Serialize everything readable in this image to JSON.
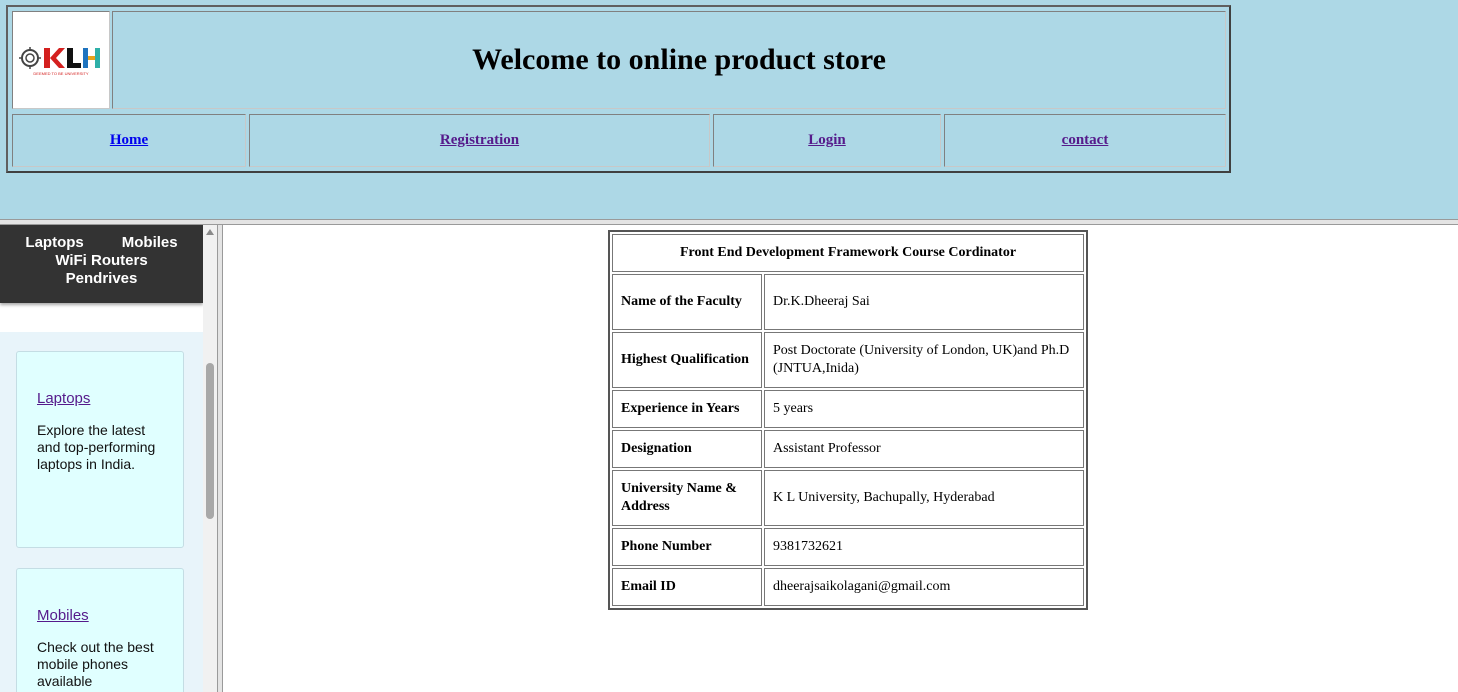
{
  "header": {
    "logo_text": "KLH",
    "logo_subtext": "DEEMED TO BE UNIVERSITY",
    "title": "Welcome to online product store",
    "nav": [
      {
        "label": "Home"
      },
      {
        "label": "Registration"
      },
      {
        "label": "Login"
      },
      {
        "label": "contact"
      }
    ]
  },
  "sidebar": {
    "categories": [
      "Laptops",
      "Mobiles",
      "WiFi Routers",
      "Pendrives"
    ],
    "cards": [
      {
        "title": "Laptops",
        "text": "Explore the latest and top-performing laptops in India."
      },
      {
        "title": "Mobiles",
        "text": "Check out the best mobile phones available"
      }
    ]
  },
  "table": {
    "heading": "Front End Development Framework Course Cordinator",
    "rows": [
      {
        "label": "Name of the Faculty",
        "value": "Dr.K.Dheeraj Sai"
      },
      {
        "label": "Highest Qualification",
        "value": "Post Doctorate (University of London, UK)and Ph.D (JNTUA,Inida)"
      },
      {
        "label": "Experience in Years",
        "value": "5 years"
      },
      {
        "label": "Designation",
        "value": "Assistant Professor"
      },
      {
        "label": "University Name & Address",
        "value": "K L University, Bachupally, Hyderabad"
      },
      {
        "label": "Phone Number",
        "value": "9381732621"
      },
      {
        "label": "Email ID",
        "value": "dheerajsaikolagani@gmail.com"
      }
    ]
  },
  "colors": {
    "header_bg": "#add8e6",
    "sidebar_nav_bg": "#333333",
    "card_bg": "#e0ffff",
    "visited_link": "#551a8b",
    "link": "#0000ee"
  }
}
